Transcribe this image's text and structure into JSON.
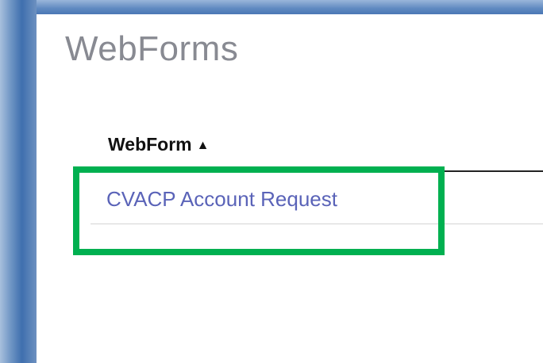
{
  "page": {
    "title": "WebForms"
  },
  "table": {
    "column_header": "WebForm",
    "sort_indicator": "▲",
    "rows": [
      {
        "label": "CVACP Account Request"
      }
    ]
  },
  "colors": {
    "title": "#888a92",
    "link": "#5a63b8",
    "highlight": "#00b050",
    "window_frame": "#4a77b5"
  },
  "icons": {
    "sort": "sort-ascending-icon"
  }
}
